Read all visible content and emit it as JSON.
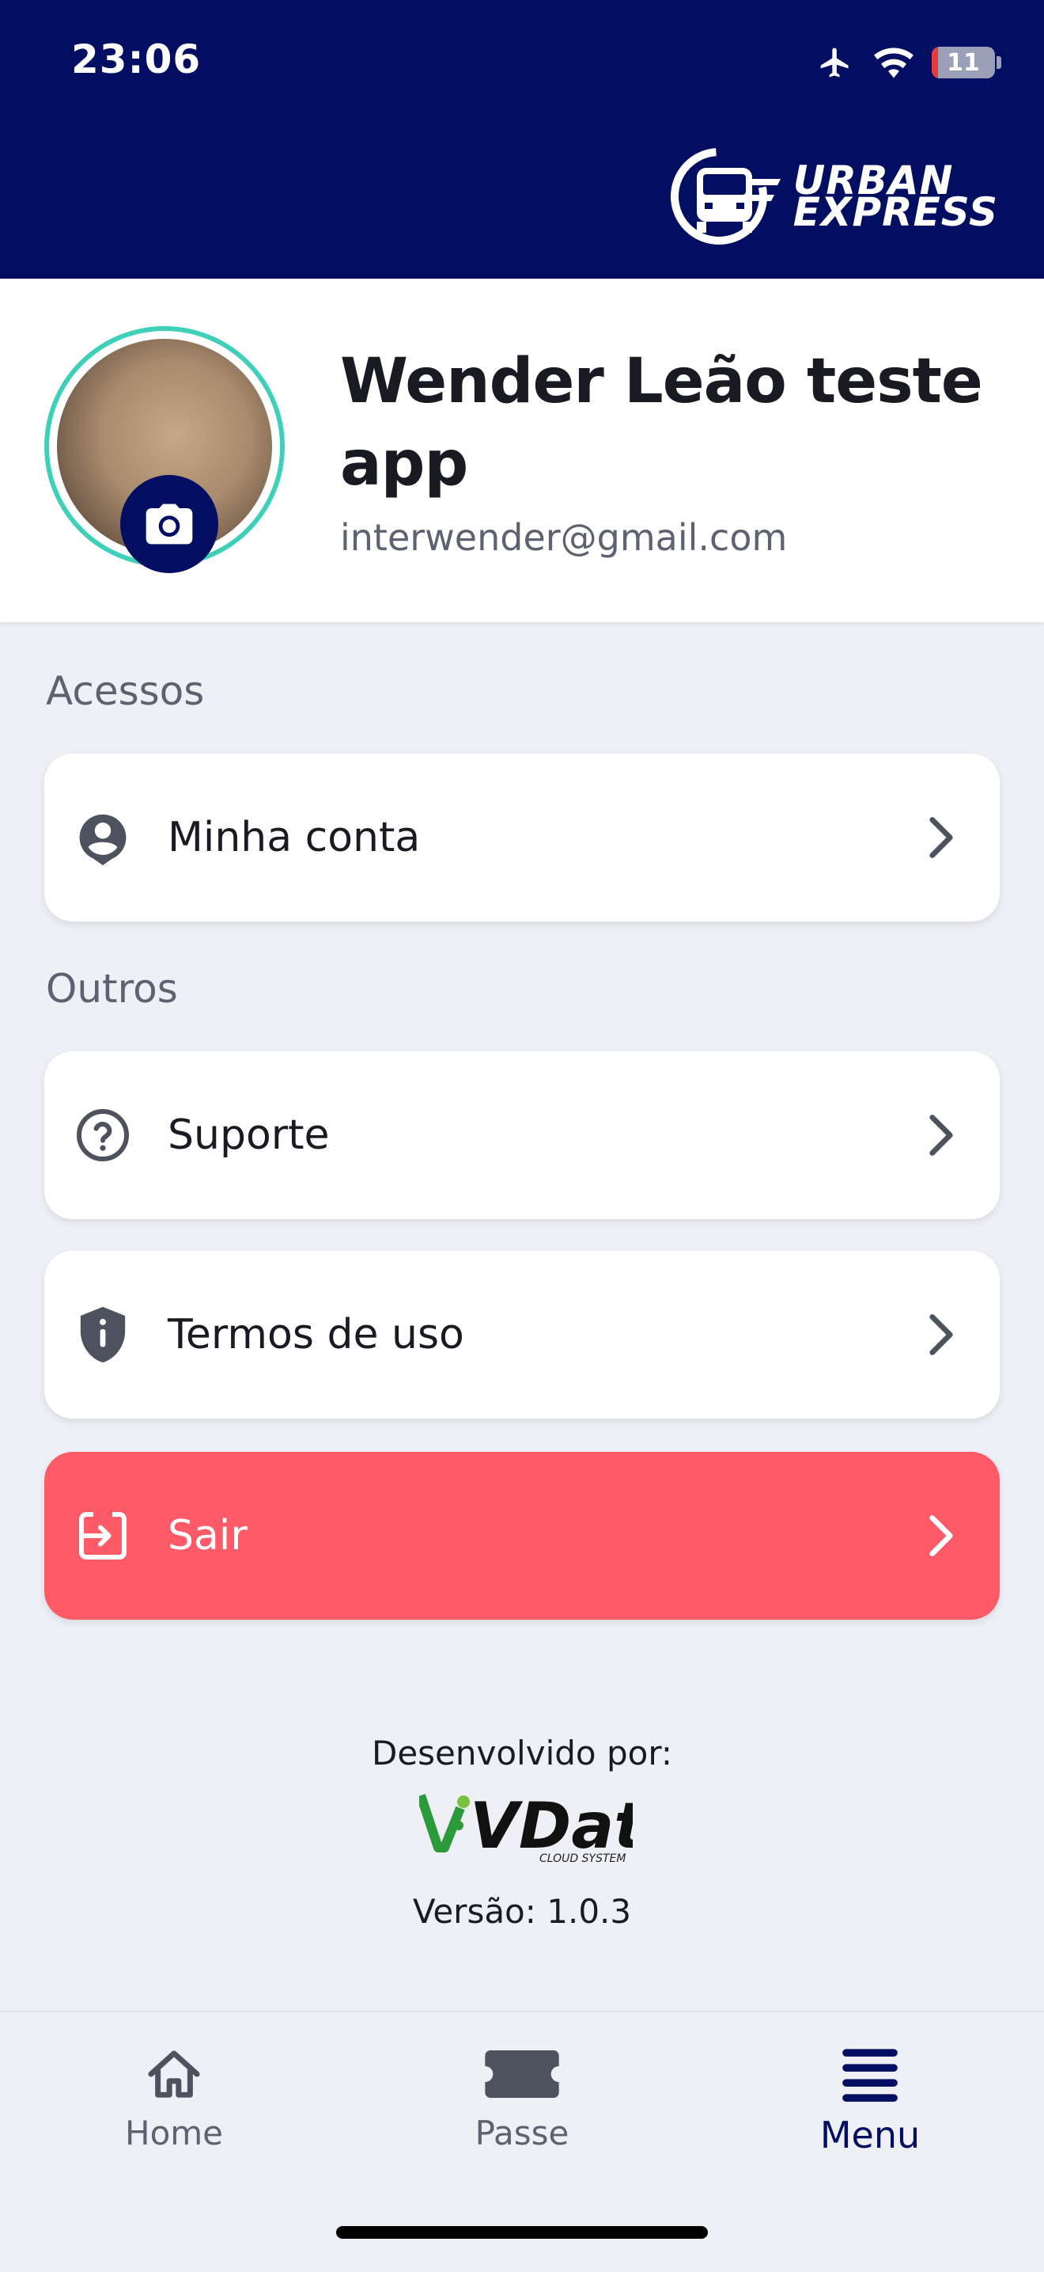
{
  "status_bar": {
    "time": "23:06",
    "battery_level": "11"
  },
  "brand": {
    "logo_line1": "URBAN",
    "logo_line2": "EXPRESS"
  },
  "profile": {
    "name": "Wender Leão teste app",
    "email": "interwender@gmail.com"
  },
  "sections": {
    "accesses": {
      "title": "Acessos",
      "items": [
        {
          "label": "Minha conta",
          "icon": "account-circle-icon"
        }
      ]
    },
    "others": {
      "title": "Outros",
      "items": [
        {
          "label": "Suporte",
          "icon": "help-circle-icon"
        },
        {
          "label": "Termos de uso",
          "icon": "shield-icon"
        },
        {
          "label": "Sair",
          "icon": "logout-icon"
        }
      ]
    }
  },
  "credits": {
    "developed_by": "Desenvolvido por:",
    "developer_logo": "VData",
    "developer_logo_sub": "CLOUD SYSTEM",
    "version": "Versão: 1.0.3"
  },
  "tab_bar": {
    "items": [
      {
        "label": "Home",
        "icon": "home-icon"
      },
      {
        "label": "Passe",
        "icon": "ticket-icon"
      },
      {
        "label": "Menu",
        "icon": "menu-icon",
        "active": true
      }
    ]
  },
  "colors": {
    "header": "#020e62",
    "danger": "#fe5a67",
    "avatar_ring": "#3ed0b8",
    "background": "#eef0f5"
  }
}
